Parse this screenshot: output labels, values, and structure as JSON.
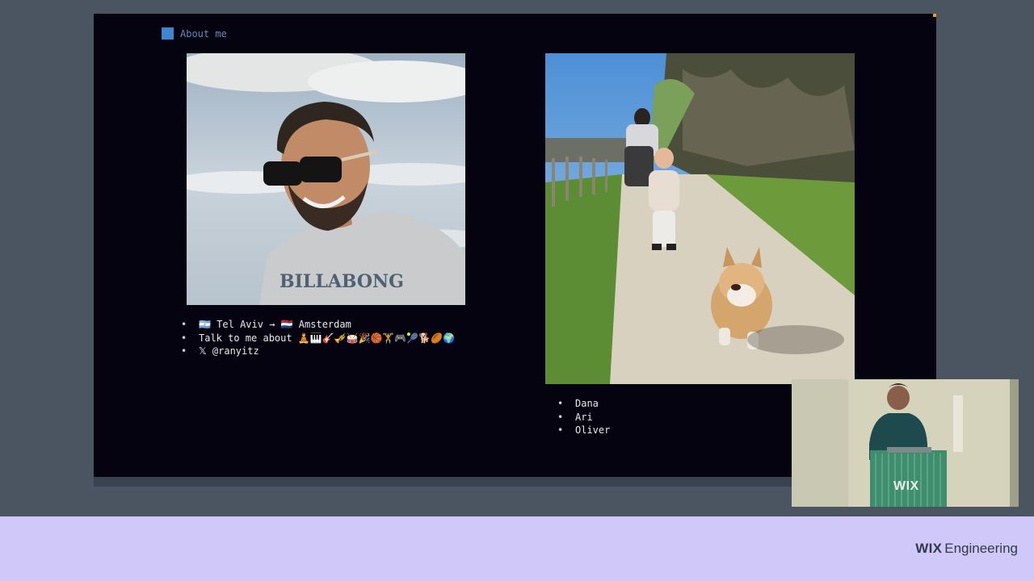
{
  "slide": {
    "title": "About me",
    "accent_color": "#3d87d0",
    "about_list": [
      "🇦🇷 Tel Aviv → 🇳🇱 Amsterdam",
      "Talk to me about 🧘🎹🎸🎺🥁🎉🏀🏋🎮🎾🐕🏉🌍",
      "𝕏 @ranyitz"
    ],
    "family_list": [
      "Dana",
      "Ari",
      "Oliver"
    ]
  },
  "webcam": {
    "logo": "WIX"
  },
  "footer": {
    "brand_wix": "WIX",
    "brand_engineering": "Engineering",
    "background_color": "#d0c8f8"
  }
}
